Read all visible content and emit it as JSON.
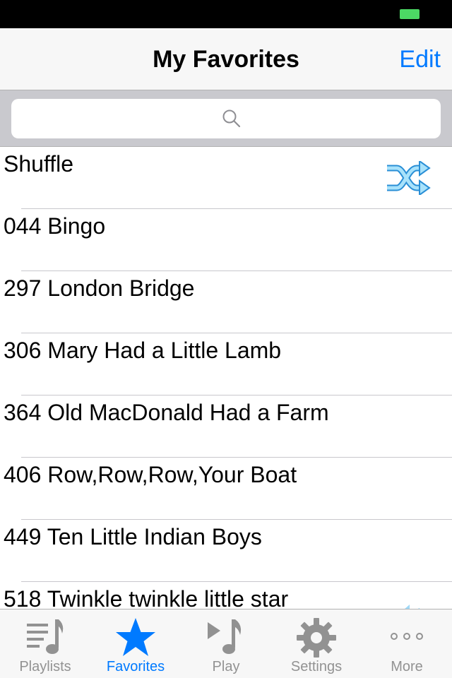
{
  "colors": {
    "accent": "#007aff",
    "inactive_tab": "#929292",
    "battery": "#4cd964",
    "shuffle_icon": "#5ac8fa"
  },
  "nav": {
    "title": "My Favorites",
    "edit_label": "Edit"
  },
  "search": {
    "icon": "search-icon"
  },
  "list": {
    "items": [
      {
        "label": "Shuffle",
        "icon": "shuffle-icon"
      },
      {
        "label": "044 Bingo"
      },
      {
        "label": "297 London Bridge"
      },
      {
        "label": "306 Mary Had a Little Lamb"
      },
      {
        "label": "364 Old MacDonald Had a Farm"
      },
      {
        "label": "406 Row,Row,Row,Your Boat"
      },
      {
        "label": "449 Ten Little Indian Boys"
      },
      {
        "label": "518 Twinkle twinkle little star",
        "icon": "speaker-icon"
      }
    ]
  },
  "tabs": [
    {
      "label": "Playlists",
      "icon": "playlist-icon",
      "active": false
    },
    {
      "label": "Favorites",
      "icon": "star-icon",
      "active": true
    },
    {
      "label": "Play",
      "icon": "play-music-icon",
      "active": false
    },
    {
      "label": "Settings",
      "icon": "gear-icon",
      "active": false
    },
    {
      "label": "More",
      "icon": "more-dots-icon",
      "active": false
    }
  ]
}
